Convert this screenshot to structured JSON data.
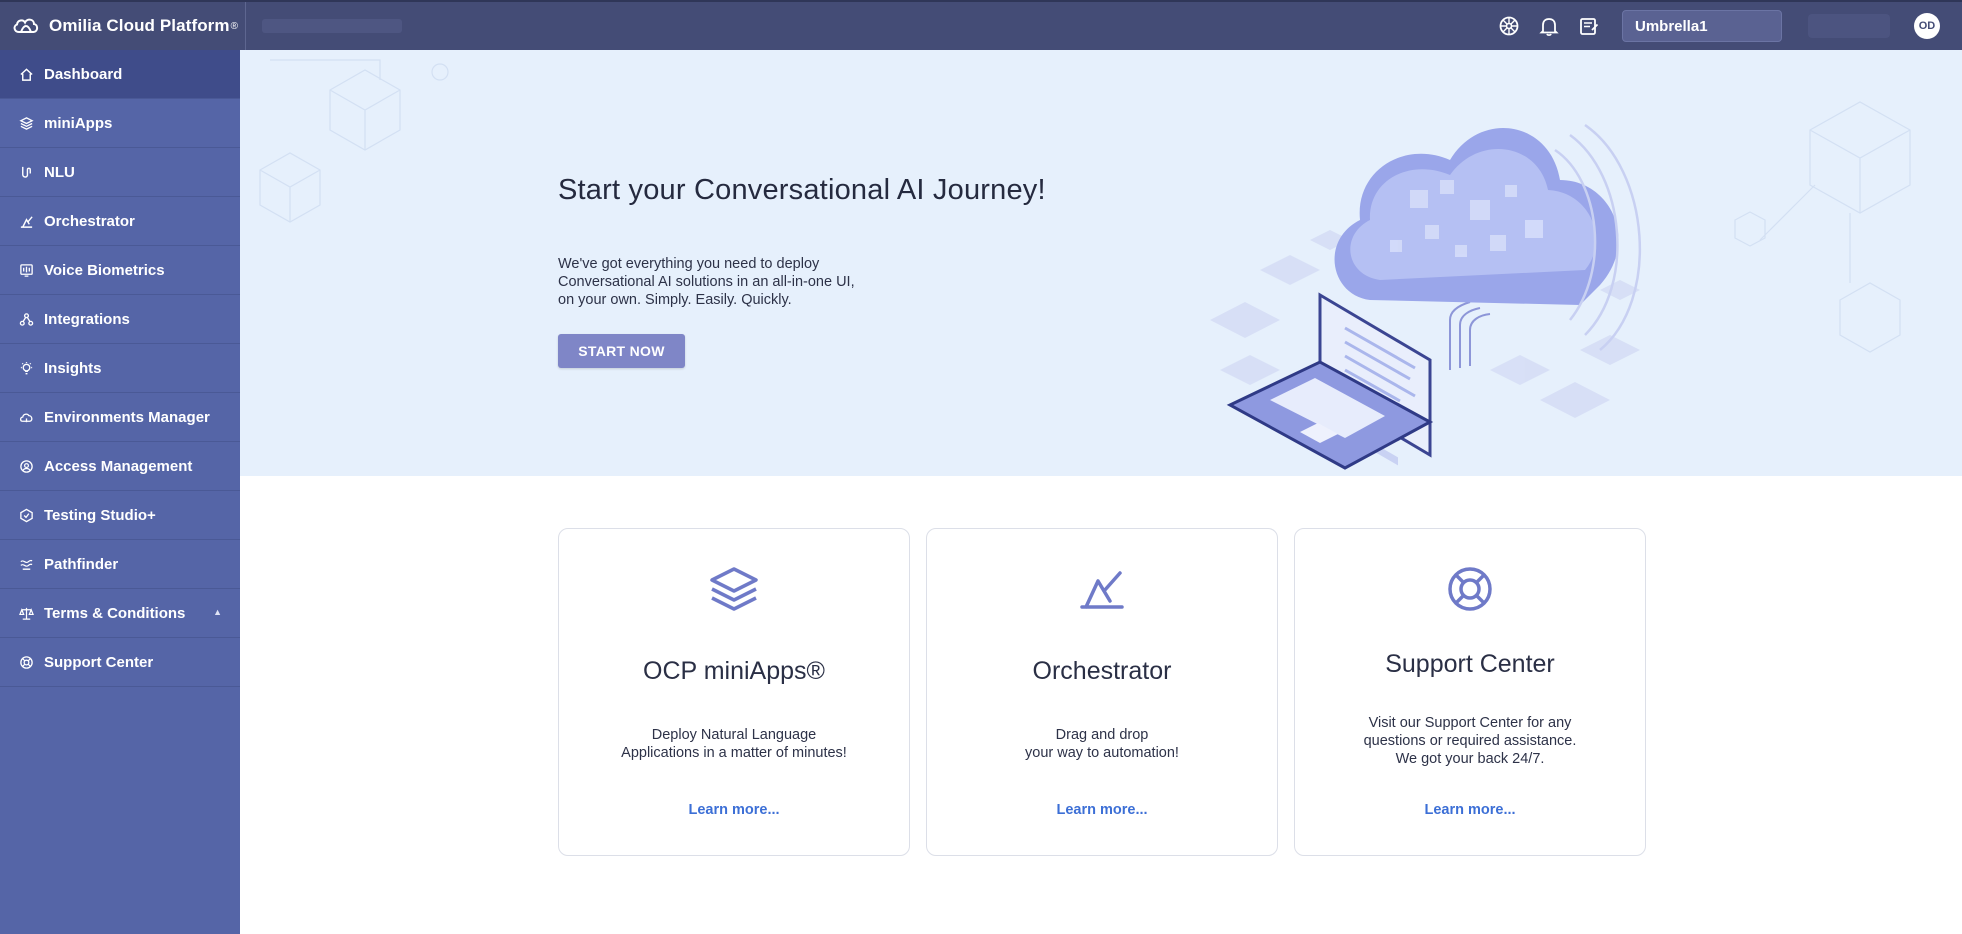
{
  "brand": {
    "name": "Omilia Cloud Platform",
    "reg": "®"
  },
  "topbar": {
    "environment": "Umbrella1",
    "avatar_initials": "OD",
    "icons": [
      "settings-wheel-icon",
      "bell-icon",
      "notes-icon"
    ]
  },
  "sidebar": {
    "items": [
      {
        "label": "Dashboard",
        "icon": "home-icon",
        "active": true
      },
      {
        "label": "miniApps",
        "icon": "layers-icon"
      },
      {
        "label": "NLU",
        "icon": "nlu-icon"
      },
      {
        "label": "Orchestrator",
        "icon": "orchestrator-icon"
      },
      {
        "label": "Voice Biometrics",
        "icon": "voice-biometrics-icon"
      },
      {
        "label": "Integrations",
        "icon": "integrations-icon"
      },
      {
        "label": "Insights",
        "icon": "lightbulb-icon"
      },
      {
        "label": "Environments Manager",
        "icon": "cloud-icon"
      },
      {
        "label": "Access Management",
        "icon": "access-icon"
      },
      {
        "label": "Testing Studio+",
        "icon": "testing-icon"
      },
      {
        "label": "Pathfinder",
        "icon": "pathfinder-icon"
      },
      {
        "label": "Terms & Conditions",
        "icon": "scales-icon",
        "caret": "▲"
      },
      {
        "label": "Support Center",
        "icon": "lifebuoy-icon"
      }
    ]
  },
  "hero": {
    "title": "Start your Conversational AI Journey!",
    "text_lines": [
      "We've got everything you need to deploy",
      "Conversational AI solutions in an all-in-one UI,",
      "on your own. Simply. Easily. Quickly."
    ],
    "button": "START NOW"
  },
  "cards": [
    {
      "title": "OCP miniApps®",
      "desc_lines": [
        "Deploy Natural Language",
        "Applications in a matter of minutes!"
      ],
      "link": "Learn more..."
    },
    {
      "title": "Orchestrator",
      "desc_lines": [
        "Drag and drop",
        "your way to automation!"
      ],
      "link": "Learn more..."
    },
    {
      "title": "Support Center",
      "desc_lines": [
        "Visit our Support Center for any",
        "questions or required assistance.",
        "We got your back 24/7."
      ],
      "link": "Learn more..."
    }
  ],
  "colors": {
    "topbar": "#444c76",
    "sidebar": "#5565a7",
    "sidebar_active": "#3f4c8a",
    "hero_bg": "#e6f0fc",
    "accent": "#7f86c7",
    "link": "#3c6fd6"
  }
}
